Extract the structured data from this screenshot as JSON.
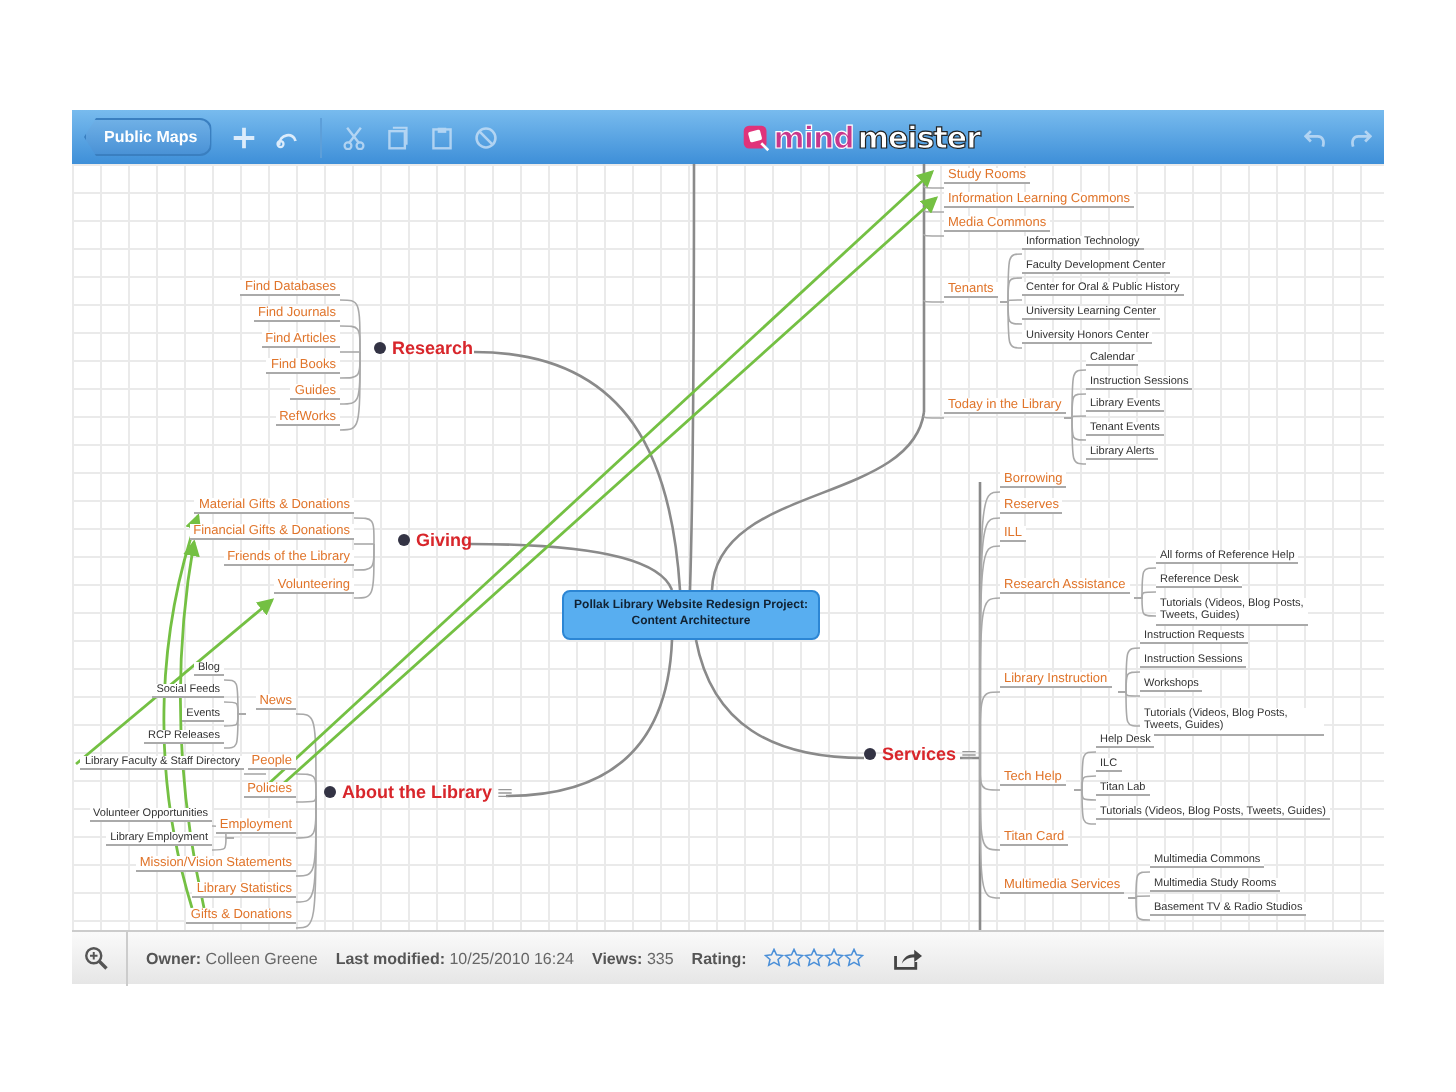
{
  "toolbar": {
    "back_button": "Public Maps",
    "logo": {
      "first": "mind",
      "second": "meister"
    }
  },
  "map": {
    "central": "Pollak Library Website Redesign Project: Content Architecture",
    "branches": [
      {
        "children": [
          {
            "label": "Study Rooms"
          },
          {
            "label": "Information Learning Commons"
          },
          {
            "label": "Media Commons"
          },
          {
            "label": "Tenants",
            "children": [
              {
                "label": "Information Technology"
              },
              {
                "label": "Faculty Development Center"
              },
              {
                "label": "Center for Oral & Public History"
              },
              {
                "label": "University Learning Center"
              },
              {
                "label": "University Honors Center"
              }
            ]
          },
          {
            "label": "Today in the Library",
            "children": [
              {
                "label": "Calendar"
              },
              {
                "label": "Instruction Sessions"
              },
              {
                "label": "Library Events"
              },
              {
                "label": "Tenant Events"
              },
              {
                "label": "Library Alerts"
              }
            ]
          }
        ]
      },
      {
        "label": "Research",
        "children": [
          {
            "label": "Find Databases"
          },
          {
            "label": "Find Journals"
          },
          {
            "label": "Find Articles"
          },
          {
            "label": "Find Books"
          },
          {
            "label": "Guides"
          },
          {
            "label": "RefWorks"
          }
        ]
      },
      {
        "label": "Giving",
        "children": [
          {
            "label": "Material Gifts & Donations"
          },
          {
            "label": "Financial Gifts & Donations"
          },
          {
            "label": "Friends of the Library"
          },
          {
            "label": "Volunteering"
          }
        ]
      },
      {
        "label": "About the Library",
        "note": true,
        "children": [
          {
            "label": "News",
            "children": [
              {
                "label": "Blog"
              },
              {
                "label": "Social Feeds"
              },
              {
                "label": "Events"
              },
              {
                "label": "RCP Releases"
              }
            ]
          },
          {
            "label": "People",
            "children": [
              {
                "label": "Library Faculty & Staff Directory"
              }
            ]
          },
          {
            "label": "Policies"
          },
          {
            "label": "Employment",
            "children": [
              {
                "label": "Volunteer Opportunities"
              },
              {
                "label": "Library Employment"
              }
            ]
          },
          {
            "label": "Mission/Vision Statements"
          },
          {
            "label": "Library Statistics"
          },
          {
            "label": "Gifts & Donations"
          }
        ]
      },
      {
        "label": "Services",
        "note": true,
        "children": [
          {
            "label": "Borrowing"
          },
          {
            "label": "Reserves"
          },
          {
            "label": "ILL"
          },
          {
            "label": "Research Assistance",
            "children": [
              {
                "label": "All forms of Reference Help"
              },
              {
                "label": "Reference Desk"
              },
              {
                "label": "Tutorials (Videos, Blog Posts, Tweets, Guides)"
              }
            ]
          },
          {
            "label": "Library Instruction",
            "children": [
              {
                "label": "Instruction Requests"
              },
              {
                "label": "Instruction Sessions"
              },
              {
                "label": "Workshops"
              },
              {
                "label": "Tutorials (Videos, Blog Posts, Tweets, Guides)"
              }
            ]
          },
          {
            "label": "Tech Help",
            "children": [
              {
                "label": "Help Desk"
              },
              {
                "label": "ILC"
              },
              {
                "label": "Titan Lab"
              },
              {
                "label": "Tutorials (Videos, Blog Posts, Tweets, Guides)"
              }
            ]
          },
          {
            "label": "Titan Card"
          },
          {
            "label": "Multimedia Services",
            "children": [
              {
                "label": "Multimedia Commons"
              },
              {
                "label": "Multimedia Study Rooms"
              },
              {
                "label": "Basement TV & Radio Studios"
              }
            ]
          }
        ]
      }
    ]
  },
  "footer": {
    "owner_label": "Owner:",
    "owner": "Colleen Greene",
    "modified_label": "Last modified:",
    "modified": "10/25/2010 16:24",
    "views_label": "Views:",
    "views": "335",
    "rating_label": "Rating:",
    "stars": 0
  }
}
